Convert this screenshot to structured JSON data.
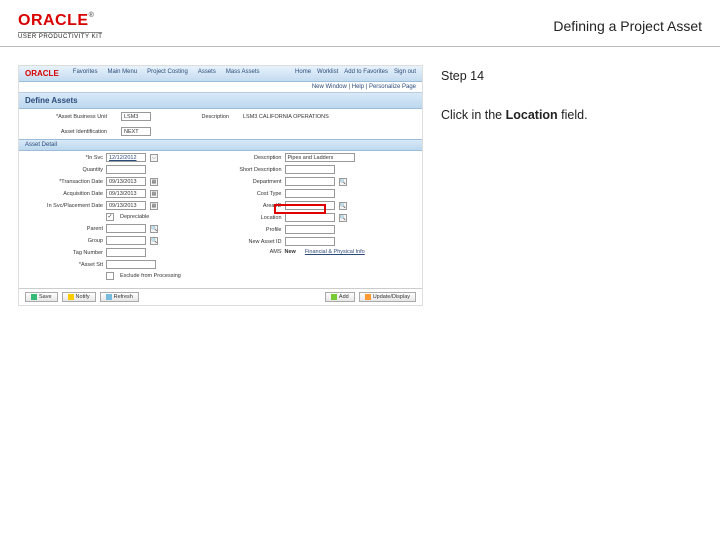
{
  "header": {
    "brand": "ORACLE",
    "tm": "®",
    "product_line": "USER PRODUCTIVITY KIT",
    "title": "Defining a Project Asset"
  },
  "instructions": {
    "step_label": "Step 14",
    "text_before": "Click in the ",
    "field_name": "Location",
    "text_after": " field."
  },
  "screenshot": {
    "menubar": {
      "logo": "ORACLE",
      "items": [
        "Favorites",
        "Main Menu",
        "Project Costing",
        "Assets",
        "Mass Assets"
      ],
      "right": [
        "Home",
        "Worklist",
        "Add to Favorites",
        "Sign out"
      ]
    },
    "subbar": "New Window | Help | Personalize Page",
    "page_title": "Define Assets",
    "top_form": {
      "bu_label": "*Asset Business Unit",
      "bu_value": "LSM3",
      "desc_label": "Description",
      "desc_value": "LSM3 CALIFORNIA OPERATIONS",
      "id_label": "Asset Identification",
      "id_value": "NEXT"
    },
    "section": "Asset Detail",
    "left_col": {
      "date_label": "*In Svc",
      "date_value": "12/12/2012",
      "qty_label": "Quantity",
      "trans_label": "*Transaction Date",
      "trans_value": "09/13/2013",
      "acq_label": "Acquisition Date",
      "acq_value": "09/13/2013",
      "place_label": "In Svc/Placement Date",
      "place_value": "09/13/2013",
      "dep_cb_label": "Depreciable",
      "dep_checked": "✓",
      "parent_label": "Parent",
      "group_label": "Group",
      "tag_label": "Tag Number",
      "status_label": "*Asset Stt",
      "exclude_cb_label": "Exclude from Processing"
    },
    "right_col": {
      "desc_label": "Description",
      "desc_val": "Pipes and Ladders",
      "short_label": "Short Description",
      "dept_label": "Department",
      "cost_label": "Cost Type",
      "area_label": "Area ID",
      "loc_label": "Location",
      "profile_label": "Profile",
      "newasset_label": "New Asset ID",
      "ams_label": "AMS",
      "ams_value": "New",
      "link_text": "Financial & Physical Info"
    },
    "buttons": {
      "save": "Save",
      "notify": "Notify",
      "refresh": "Refresh",
      "add": "Add",
      "update": "Update/Display"
    }
  }
}
